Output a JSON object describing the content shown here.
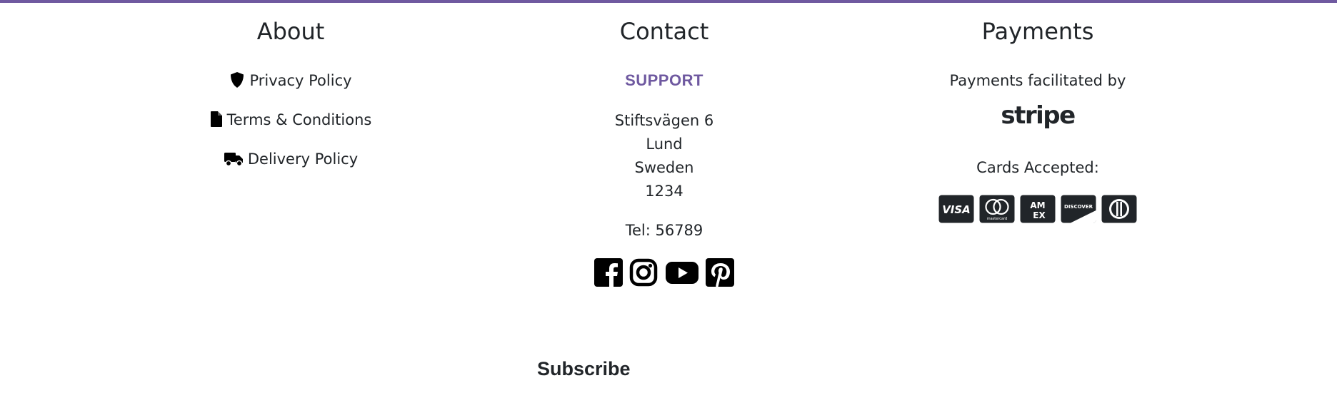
{
  "colors": {
    "accent": "#6f59a0",
    "text": "#212529"
  },
  "about": {
    "title": "About",
    "links": [
      {
        "label": "Privacy Policy",
        "icon": "shield-icon"
      },
      {
        "label": "Terms & Conditions",
        "icon": "file-icon"
      },
      {
        "label": "Delivery Policy",
        "icon": "truck-icon"
      }
    ]
  },
  "contact": {
    "title": "Contact",
    "support": "SUPPORT",
    "address": [
      "Stiftsvägen 6",
      "Lund",
      "Sweden",
      "1234"
    ],
    "tel": "Tel: 56789",
    "social": [
      "facebook-icon",
      "instagram-icon",
      "youtube-icon",
      "pinterest-icon"
    ]
  },
  "payments": {
    "title": "Payments",
    "facilitated": "Payments facilitated by",
    "provider": "stripe",
    "cards_label": "Cards Accepted:",
    "cards": [
      {
        "icon": "visa-icon",
        "text": "VISA"
      },
      {
        "icon": "mastercard-icon",
        "text": "mastercard"
      },
      {
        "icon": "amex-icon",
        "text": "AM EX"
      },
      {
        "icon": "discover-icon",
        "text": "DISCOVER"
      },
      {
        "icon": "diners-icon",
        "text": ""
      }
    ]
  },
  "subscribe": {
    "title": "Subscribe"
  }
}
